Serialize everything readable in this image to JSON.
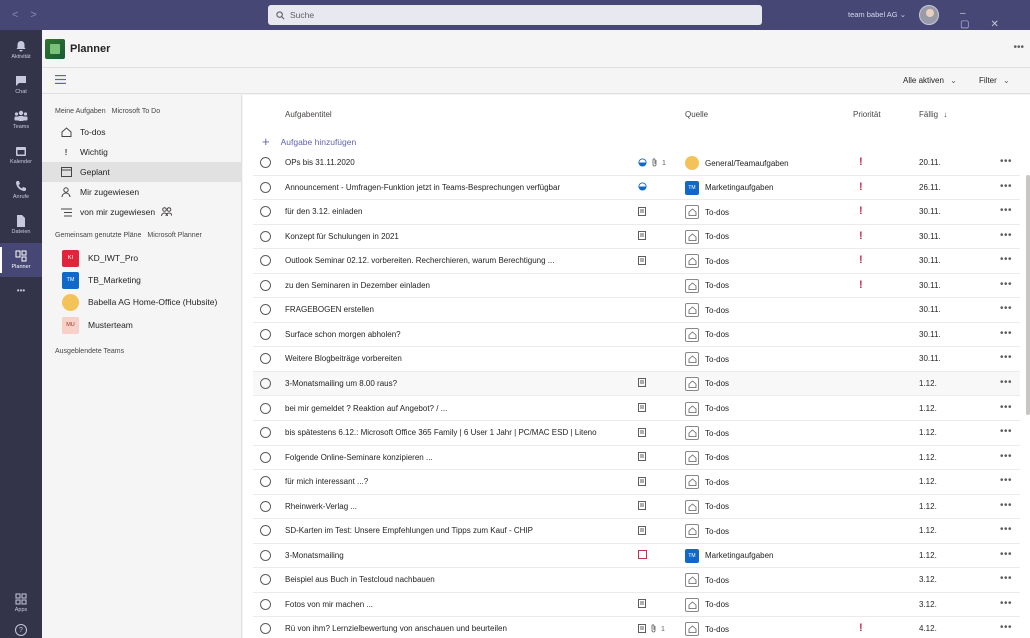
{
  "titlebar": {
    "search_placeholder": "Suche",
    "org_name": "team babel AG",
    "org_chevron": "⌄"
  },
  "rail": {
    "items": [
      {
        "label": "Aktivität",
        "icon": "bell-icon"
      },
      {
        "label": "Chat",
        "icon": "chat-icon"
      },
      {
        "label": "Teams",
        "icon": "teams-icon"
      },
      {
        "label": "Kalender",
        "icon": "calendar-icon"
      },
      {
        "label": "Anrufe",
        "icon": "phone-icon"
      },
      {
        "label": "Dateien",
        "icon": "file-icon"
      },
      {
        "label": "Planner",
        "icon": "planner-icon"
      }
    ],
    "more": "•••",
    "apps_label": "Apps",
    "help_label": "?"
  },
  "app": {
    "title": "Planner",
    "more": "•••"
  },
  "toolbar": {
    "view_label": "Alle aktiven",
    "filter_label": "Filter"
  },
  "sidebar": {
    "my_tasks": "Meine Aufgaben",
    "my_tasks_sub": "Microsoft To Do",
    "nav": [
      {
        "label": "To-dos",
        "icon": "home-icon"
      },
      {
        "label": "Wichtig",
        "icon": "exclamation-icon"
      },
      {
        "label": "Geplant",
        "icon": "calendar-grid-icon"
      },
      {
        "label": "Mir zugewiesen",
        "icon": "person-icon"
      },
      {
        "label": "von mir zugewiesen",
        "icon": "list-icon"
      }
    ],
    "shared_plans": "Gemeinsam genutzte Pläne",
    "shared_plans_sub": "Microsoft Planner",
    "plans": [
      {
        "label": "KD_IWT_Pro",
        "avatar": "KI",
        "color": "#e0243a"
      },
      {
        "label": "TB_Marketing",
        "avatar": "TM",
        "color": "#1068c8"
      },
      {
        "label": "Babella AG Home-Office (Hubsite)",
        "avatar": "",
        "color": "#f3c35a"
      },
      {
        "label": "Musterteam",
        "avatar": "MU",
        "color": "#f7d0c8"
      }
    ],
    "hidden_teams": "Ausgeblendete Teams"
  },
  "list": {
    "columns": {
      "title": "Aufgabentitel",
      "source": "Quelle",
      "priority": "Priorität",
      "due": "Fällig",
      "sort_icon": "↓"
    },
    "add_task": "Aufgabe hinzufügen",
    "rows": [
      {
        "title": "OPs bis 31.11.2020",
        "source": "General/Teamaufgaben",
        "source_type": "gen",
        "due": "20.11.",
        "prio": true,
        "ind": "progress",
        "attach": "1"
      },
      {
        "title": "Announcement - Umfragen-Funktion jetzt in Teams-Besprechungen verfügbar",
        "source": "Marketingaufgaben",
        "source_type": "tm",
        "due": "26.11.",
        "prio": true,
        "ind": "progress",
        "attach": ""
      },
      {
        "title": "für den 3.12. einladen",
        "source": "To-dos",
        "source_type": "todo",
        "due": "30.11.",
        "prio": true,
        "ind": "note",
        "attach": ""
      },
      {
        "title": "Konzept für Schulungen in 2021",
        "source": "To-dos",
        "source_type": "todo",
        "due": "30.11.",
        "prio": true,
        "ind": "note",
        "attach": ""
      },
      {
        "title": "Outlook Seminar 02.12. vorbereiten. Recherchieren, warum Berechtigung ...",
        "source": "To-dos",
        "source_type": "todo",
        "due": "30.11.",
        "prio": true,
        "ind": "note",
        "attach": ""
      },
      {
        "title": "zu den Seminaren in Dezember einladen",
        "source": "To-dos",
        "source_type": "todo",
        "due": "30.11.",
        "prio": true,
        "ind": "",
        "attach": ""
      },
      {
        "title": "FRAGEBOGEN erstellen",
        "source": "To-dos",
        "source_type": "todo",
        "due": "30.11.",
        "prio": false,
        "ind": "",
        "attach": ""
      },
      {
        "title": "Surface schon morgen abholen?",
        "source": "To-dos",
        "source_type": "todo",
        "due": "30.11.",
        "prio": false,
        "ind": "",
        "attach": ""
      },
      {
        "title": "Weitere Blogbeiträge vorbereiten",
        "source": "To-dos",
        "source_type": "todo",
        "due": "30.11.",
        "prio": false,
        "ind": "",
        "attach": ""
      },
      {
        "title": "3-Monatsmailing um 8.00 raus?",
        "source": "To-dos",
        "source_type": "todo",
        "due": "1.12.",
        "prio": false,
        "ind": "note",
        "attach": ""
      },
      {
        "title": "bei mir gemeldet ? Reaktion auf Angebot? / ...",
        "source": "To-dos",
        "source_type": "todo",
        "due": "1.12.",
        "prio": false,
        "ind": "note",
        "attach": ""
      },
      {
        "title": "bis spätestens 6.12.: Microsoft Office 365 Family | 6 User 1 Jahr | PC/MAC ESD | Liteno",
        "source": "To-dos",
        "source_type": "todo",
        "due": "1.12.",
        "prio": false,
        "ind": "note",
        "attach": ""
      },
      {
        "title": "Folgende Online-Seminare konzipieren ...",
        "source": "To-dos",
        "source_type": "todo",
        "due": "1.12.",
        "prio": false,
        "ind": "note",
        "attach": ""
      },
      {
        "title": "für mich interessant ...?",
        "source": "To-dos",
        "source_type": "todo",
        "due": "1.12.",
        "prio": false,
        "ind": "note",
        "attach": ""
      },
      {
        "title": "Rheinwerk-Verlag ...",
        "source": "To-dos",
        "source_type": "todo",
        "due": "1.12.",
        "prio": false,
        "ind": "note",
        "attach": ""
      },
      {
        "title": "SD-Karten im Test: Unsere Empfehlungen und Tipps zum Kauf - CHIP",
        "source": "To-dos",
        "source_type": "todo",
        "due": "1.12.",
        "prio": false,
        "ind": "note",
        "attach": ""
      },
      {
        "title": "3-Monatsmailing",
        "source": "Marketingaufgaben",
        "source_type": "tm",
        "due": "1.12.",
        "prio": false,
        "ind": "checklist",
        "attach": ""
      },
      {
        "title": "Beispiel aus Buch in Testcloud nachbauen",
        "source": "To-dos",
        "source_type": "todo",
        "due": "3.12.",
        "prio": false,
        "ind": "",
        "attach": ""
      },
      {
        "title": "Fotos von mir machen ...",
        "source": "To-dos",
        "source_type": "todo",
        "due": "3.12.",
        "prio": false,
        "ind": "note",
        "attach": ""
      },
      {
        "title": "Rü von ihm? Lernzielbewertung von anschauen und beurteilen",
        "source": "To-dos",
        "source_type": "todo",
        "due": "4.12.",
        "prio": true,
        "ind": "note",
        "attach": "1"
      }
    ],
    "prio_mark": "!",
    "more": "•••"
  }
}
